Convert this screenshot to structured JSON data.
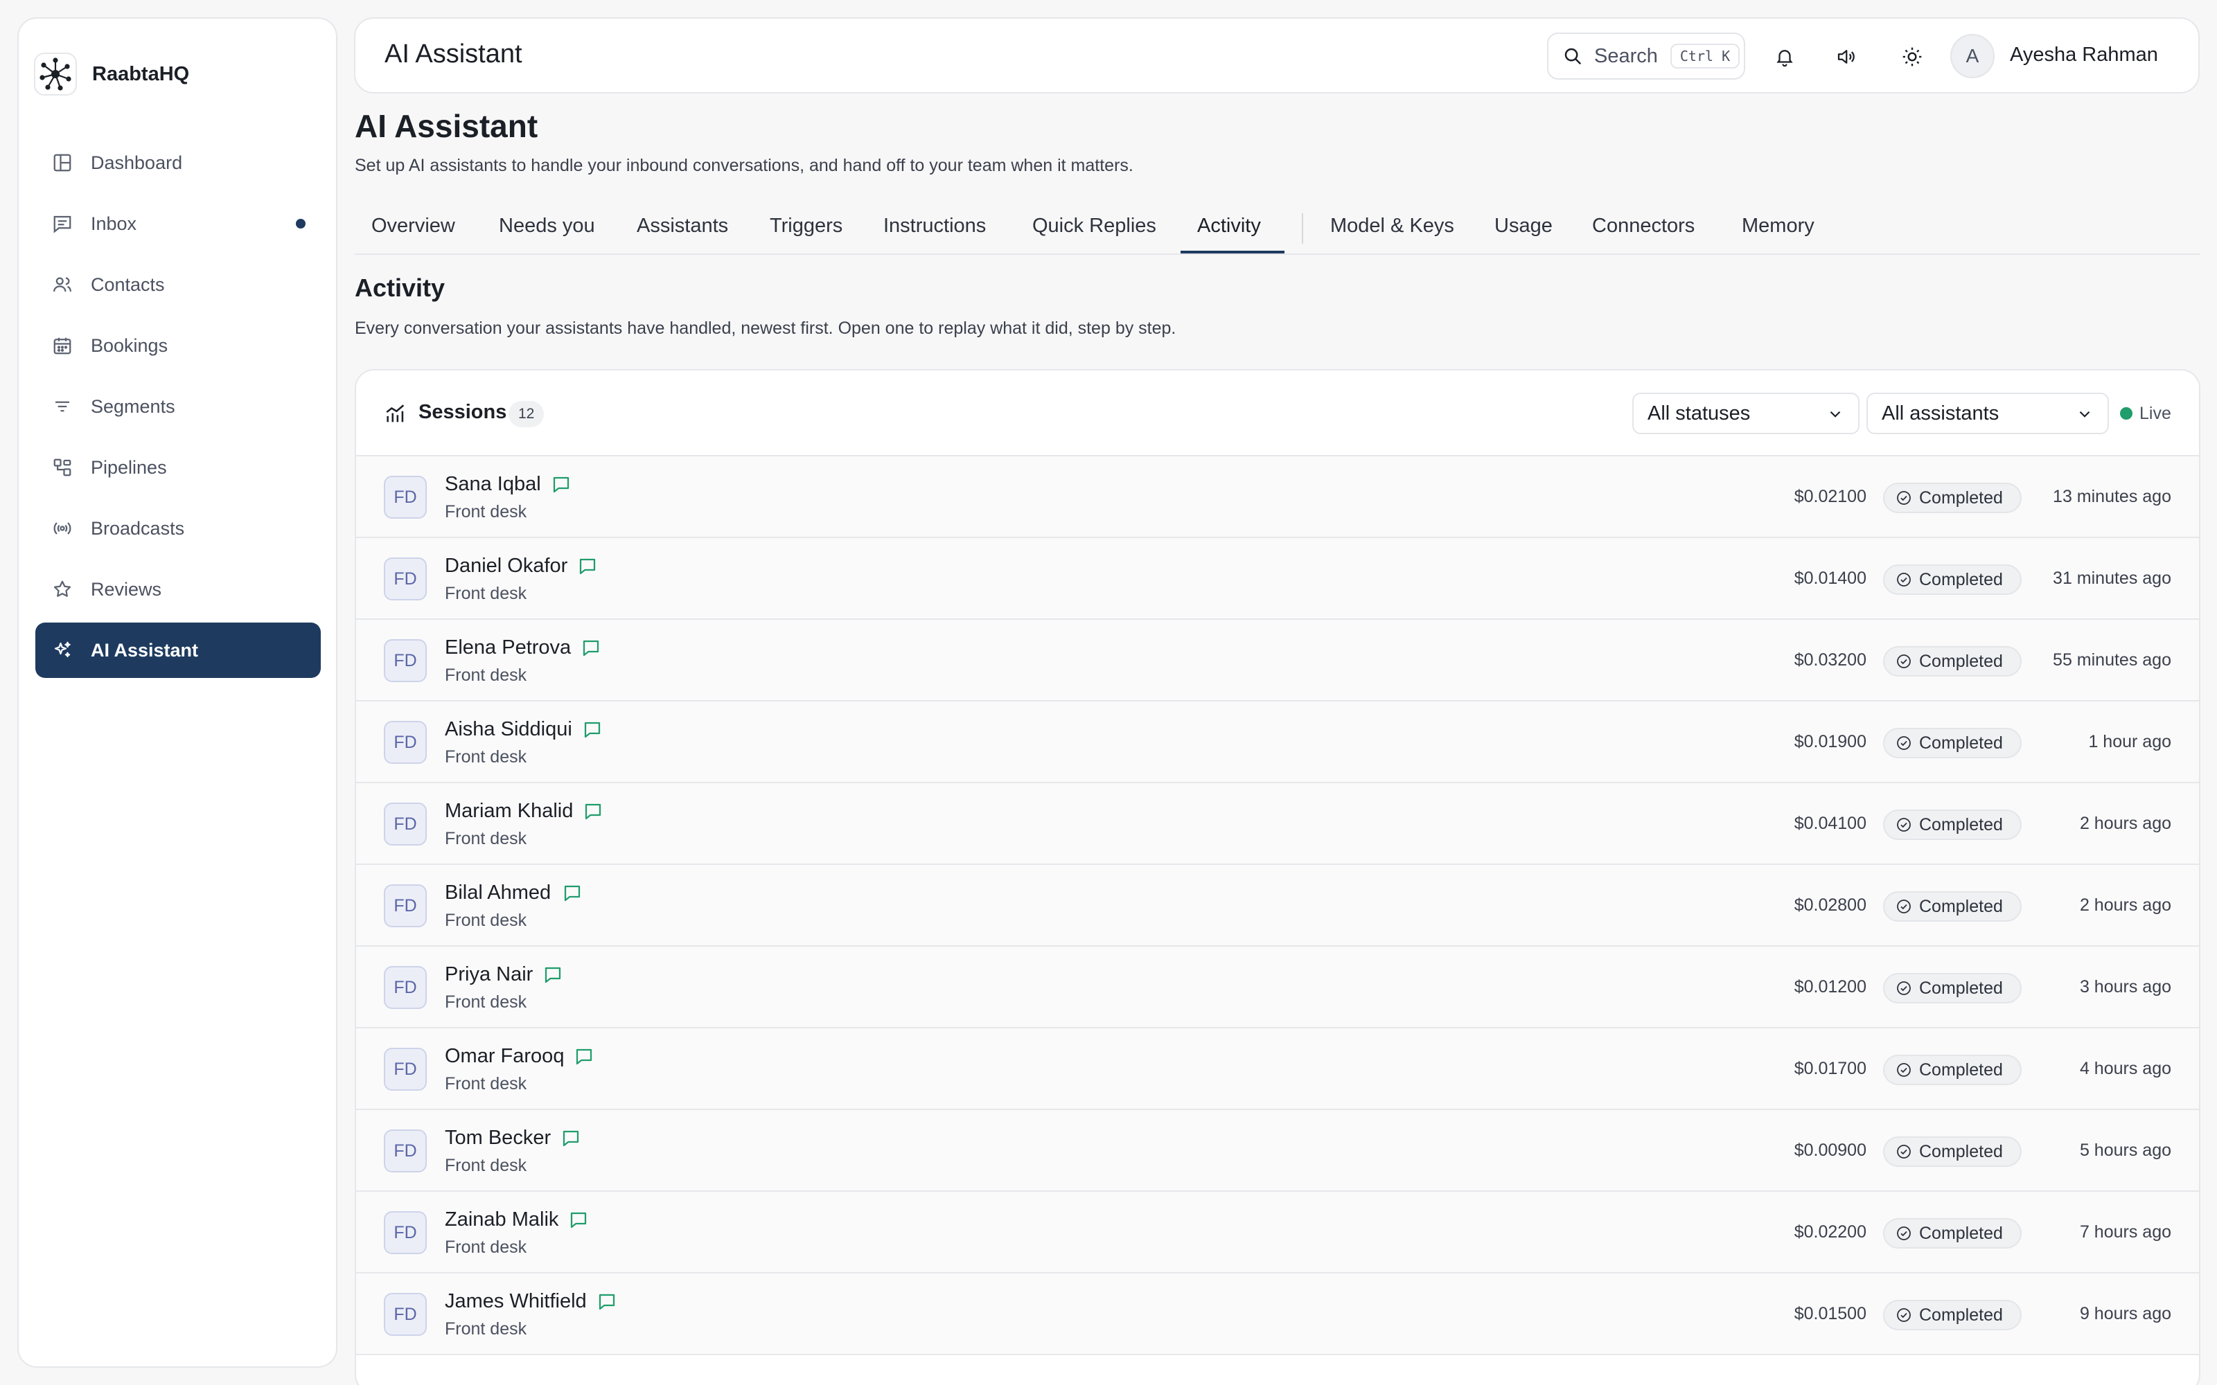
{
  "app": {
    "name": "RaabtaHQ"
  },
  "sidebar": {
    "items": [
      {
        "label": "Dashboard",
        "icon": "layout-icon"
      },
      {
        "label": "Inbox",
        "icon": "message-square-icon",
        "unread": true
      },
      {
        "label": "Contacts",
        "icon": "users-icon"
      },
      {
        "label": "Bookings",
        "icon": "calendar-icon"
      },
      {
        "label": "Segments",
        "icon": "filter-icon"
      },
      {
        "label": "Pipelines",
        "icon": "workflow-icon"
      },
      {
        "label": "Broadcasts",
        "icon": "broadcast-icon"
      },
      {
        "label": "Reviews",
        "icon": "star-icon"
      },
      {
        "label": "AI Assistant",
        "icon": "sparkles-icon",
        "active": true
      }
    ]
  },
  "header": {
    "title": "AI Assistant",
    "search_label": "Search",
    "search_shortcut": "Ctrl K",
    "user_initial": "A",
    "user_name": "Ayesha Rahman"
  },
  "page": {
    "title": "AI Assistant",
    "subtitle": "Set up AI assistants to handle your inbound conversations, and hand off to your team when it matters."
  },
  "tabs": [
    {
      "label": "Overview"
    },
    {
      "label": "Needs you"
    },
    {
      "label": "Assistants"
    },
    {
      "label": "Triggers"
    },
    {
      "label": "Instructions"
    },
    {
      "label": "Quick Replies"
    },
    {
      "label": "Activity",
      "active": true
    },
    {
      "label": "Model & Keys"
    },
    {
      "label": "Usage"
    },
    {
      "label": "Connectors"
    },
    {
      "label": "Memory"
    }
  ],
  "activity": {
    "title": "Activity",
    "subtitle": "Every conversation your assistants have handled, newest first. Open one to replay what it did, step by step."
  },
  "sessions": {
    "title": "Sessions",
    "count": "12",
    "status_filter": "All statuses",
    "assistant_filter": "All assistants",
    "live_label": "Live",
    "accent_color": "#1e3a5f",
    "live_color": "#1f9d6b",
    "rows": [
      {
        "initials": "FD",
        "name": "Sana Iqbal",
        "assistant": "Front desk",
        "cost": "$0.02100",
        "status": "Completed",
        "time": "13 minutes ago"
      },
      {
        "initials": "FD",
        "name": "Daniel Okafor",
        "assistant": "Front desk",
        "cost": "$0.01400",
        "status": "Completed",
        "time": "31 minutes ago"
      },
      {
        "initials": "FD",
        "name": "Elena Petrova",
        "assistant": "Front desk",
        "cost": "$0.03200",
        "status": "Completed",
        "time": "55 minutes ago"
      },
      {
        "initials": "FD",
        "name": "Aisha Siddiqui",
        "assistant": "Front desk",
        "cost": "$0.01900",
        "status": "Completed",
        "time": "1 hour ago"
      },
      {
        "initials": "FD",
        "name": "Mariam Khalid",
        "assistant": "Front desk",
        "cost": "$0.04100",
        "status": "Completed",
        "time": "2 hours ago"
      },
      {
        "initials": "FD",
        "name": "Bilal Ahmed",
        "assistant": "Front desk",
        "cost": "$0.02800",
        "status": "Completed",
        "time": "2 hours ago"
      },
      {
        "initials": "FD",
        "name": "Priya Nair",
        "assistant": "Front desk",
        "cost": "$0.01200",
        "status": "Completed",
        "time": "3 hours ago"
      },
      {
        "initials": "FD",
        "name": "Omar Farooq",
        "assistant": "Front desk",
        "cost": "$0.01700",
        "status": "Completed",
        "time": "4 hours ago"
      },
      {
        "initials": "FD",
        "name": "Tom Becker",
        "assistant": "Front desk",
        "cost": "$0.00900",
        "status": "Completed",
        "time": "5 hours ago"
      },
      {
        "initials": "FD",
        "name": "Zainab Malik",
        "assistant": "Front desk",
        "cost": "$0.02200",
        "status": "Completed",
        "time": "7 hours ago"
      },
      {
        "initials": "FD",
        "name": "James Whitfield",
        "assistant": "Front desk",
        "cost": "$0.01500",
        "status": "Completed",
        "time": "9 hours ago"
      }
    ]
  }
}
